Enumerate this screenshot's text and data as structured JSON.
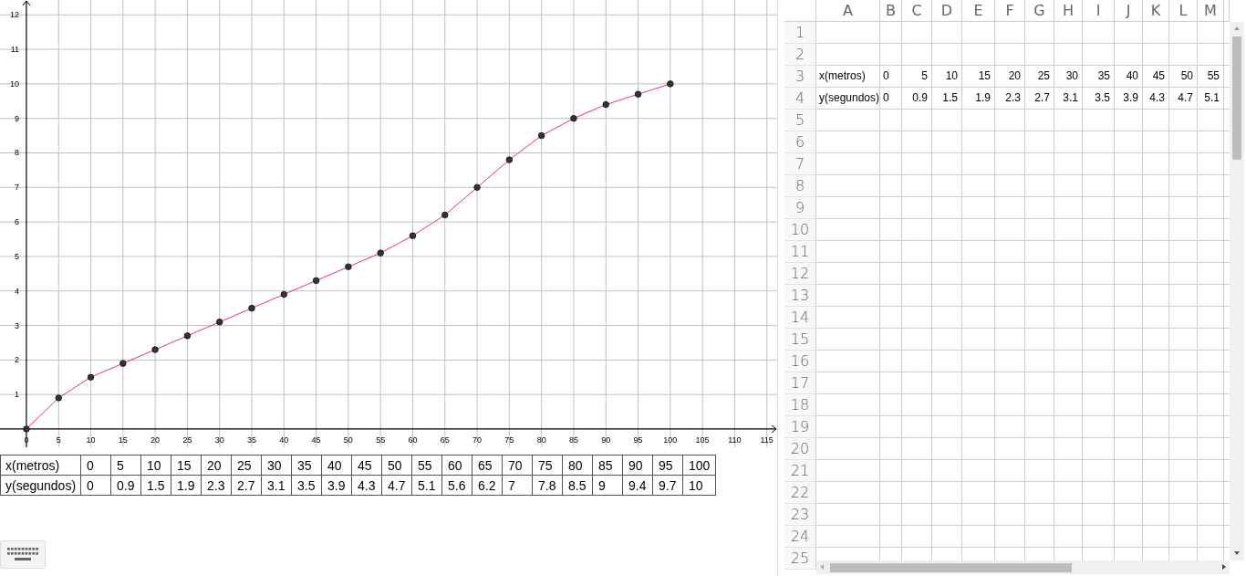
{
  "graph": {
    "chart_data": {
      "type": "line",
      "x": [
        0,
        5,
        10,
        15,
        20,
        25,
        30,
        35,
        40,
        45,
        50,
        55,
        60,
        65,
        70,
        75,
        80,
        85,
        90,
        95,
        100
      ],
      "series": [
        {
          "color": "#e8365e",
          "marker": "circle",
          "values": [
            0,
            0.9,
            1.5,
            1.9,
            2.3,
            2.7,
            3.1,
            3.5,
            3.9,
            4.3,
            4.7,
            5.1,
            5.6,
            6.2,
            7,
            7.8,
            8.5,
            9,
            9.4,
            9.7,
            10
          ]
        }
      ],
      "xlim": [
        -4.1,
        116.6
      ],
      "ylim": [
        -0.53,
        12.43
      ],
      "xticks": [
        0,
        5,
        10,
        15,
        20,
        25,
        30,
        35,
        40,
        45,
        50,
        55,
        60,
        65,
        70,
        75,
        80,
        85,
        90,
        95,
        100,
        105,
        110,
        115
      ],
      "yticks": [
        1,
        2,
        3,
        4,
        5,
        6,
        7,
        8,
        9,
        10,
        11,
        12
      ],
      "grid": true
    }
  },
  "table": {
    "rows": [
      {
        "header": "x(metros)",
        "cells": [
          "0",
          "5",
          "10",
          "15",
          "20",
          "25",
          "30",
          "35",
          "40",
          "45",
          "50",
          "55",
          "60",
          "65",
          "70",
          "75",
          "80",
          "85",
          "90",
          "95",
          "100"
        ]
      },
      {
        "header": "y(segundos)",
        "cells": [
          "0",
          "0.9",
          "1.5",
          "1.9",
          "2.3",
          "2.7",
          "3.1",
          "3.5",
          "3.9",
          "4.3",
          "4.7",
          "5.1",
          "5.6",
          "6.2",
          "7",
          "7.8",
          "8.5",
          "9",
          "9.4",
          "9.7",
          "10"
        ]
      }
    ]
  },
  "spreadsheet": {
    "columns": [
      "A",
      "B",
      "C",
      "D",
      "E",
      "F",
      "G",
      "H",
      "I",
      "J",
      "K",
      "L",
      "M"
    ],
    "rows": [
      {
        "number": "1"
      },
      {
        "number": "2"
      },
      {
        "number": "3",
        "cells": [
          "x(metros)",
          "0",
          "5",
          "10",
          "15",
          "20",
          "25",
          "30",
          "35",
          "40",
          "45",
          "50",
          "55"
        ]
      },
      {
        "number": "4",
        "cells": [
          "y(segundos)",
          "0",
          "0.9",
          "1.5",
          "1.9",
          "2.3",
          "2.7",
          "3.1",
          "3.5",
          "3.9",
          "4.3",
          "4.7",
          "5.1"
        ]
      },
      {
        "number": "5"
      },
      {
        "number": "6"
      },
      {
        "number": "7"
      },
      {
        "number": "8"
      },
      {
        "number": "9"
      },
      {
        "number": "10"
      },
      {
        "number": "11"
      },
      {
        "number": "12"
      },
      {
        "number": "13"
      },
      {
        "number": "14"
      },
      {
        "number": "15"
      },
      {
        "number": "16"
      },
      {
        "number": "17"
      },
      {
        "number": "18"
      },
      {
        "number": "19"
      },
      {
        "number": "20"
      },
      {
        "number": "21"
      },
      {
        "number": "22"
      },
      {
        "number": "23"
      },
      {
        "number": "24"
      },
      {
        "number": "25"
      }
    ]
  }
}
